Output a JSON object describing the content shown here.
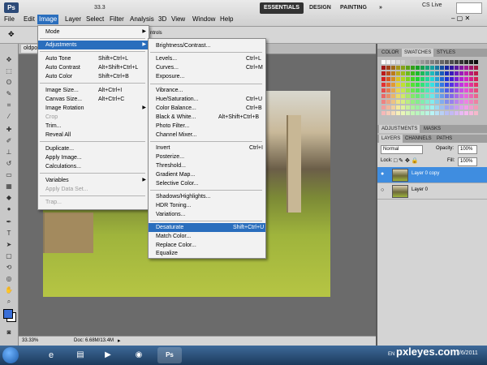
{
  "app": {
    "logo": "Ps",
    "zoom_readout": "33.3"
  },
  "menubar": {
    "items": [
      "File",
      "Edit",
      "Image",
      "Layer",
      "Select",
      "Filter",
      "Analysis",
      "3D",
      "View",
      "Window",
      "Help"
    ],
    "workspaces": [
      "ESSENTIALS",
      "DESIGN",
      "PAINTING"
    ],
    "more": "»",
    "cs_live": "CS Live",
    "window_controls": "– ▢ ✕"
  },
  "options": {
    "controls_label": "ntrols"
  },
  "document": {
    "tab_label": "oldpo",
    "zoom": "33.33%",
    "info": "Doc: 6.68M/13.4M"
  },
  "image_menu": {
    "items": [
      {
        "label": "Mode",
        "shortcut": "",
        "submenu": true,
        "disabled": false
      },
      {
        "label": "Adjustments",
        "shortcut": "",
        "submenu": true,
        "disabled": false,
        "highlight": true
      },
      {
        "label": "Auto Tone",
        "shortcut": "Shift+Ctrl+L",
        "disabled": false
      },
      {
        "label": "Auto Contrast",
        "shortcut": "Alt+Shift+Ctrl+L",
        "disabled": false
      },
      {
        "label": "Auto Color",
        "shortcut": "Shift+Ctrl+B",
        "disabled": false
      },
      {
        "label": "Image Size...",
        "shortcut": "Alt+Ctrl+I",
        "disabled": false
      },
      {
        "label": "Canvas Size...",
        "shortcut": "Alt+Ctrl+C",
        "disabled": false
      },
      {
        "label": "Image Rotation",
        "shortcut": "",
        "submenu": true,
        "disabled": false
      },
      {
        "label": "Crop",
        "shortcut": "",
        "disabled": true
      },
      {
        "label": "Trim...",
        "shortcut": "",
        "disabled": false
      },
      {
        "label": "Reveal All",
        "shortcut": "",
        "disabled": false
      },
      {
        "label": "Duplicate...",
        "shortcut": "",
        "disabled": false
      },
      {
        "label": "Apply Image...",
        "shortcut": "",
        "disabled": false
      },
      {
        "label": "Calculations...",
        "shortcut": "",
        "disabled": false
      },
      {
        "label": "Variables",
        "shortcut": "",
        "submenu": true,
        "disabled": false
      },
      {
        "label": "Apply Data Set...",
        "shortcut": "",
        "disabled": true
      },
      {
        "label": "Trap...",
        "shortcut": "",
        "disabled": true
      }
    ]
  },
  "adjust_menu": {
    "items": [
      {
        "label": "Brightness/Contrast...",
        "shortcut": ""
      },
      {
        "label": "Levels...",
        "shortcut": "Ctrl+L"
      },
      {
        "label": "Curves...",
        "shortcut": "Ctrl+M"
      },
      {
        "label": "Exposure...",
        "shortcut": ""
      },
      {
        "label": "Vibrance...",
        "shortcut": ""
      },
      {
        "label": "Hue/Saturation...",
        "shortcut": "Ctrl+U"
      },
      {
        "label": "Color Balance...",
        "shortcut": "Ctrl+B"
      },
      {
        "label": "Black & White...",
        "shortcut": "Alt+Shift+Ctrl+B"
      },
      {
        "label": "Photo Filter...",
        "shortcut": ""
      },
      {
        "label": "Channel Mixer...",
        "shortcut": ""
      },
      {
        "label": "Invert",
        "shortcut": "Ctrl+I"
      },
      {
        "label": "Posterize...",
        "shortcut": ""
      },
      {
        "label": "Threshold...",
        "shortcut": ""
      },
      {
        "label": "Gradient Map...",
        "shortcut": ""
      },
      {
        "label": "Selective Color...",
        "shortcut": ""
      },
      {
        "label": "Shadows/Highlights...",
        "shortcut": ""
      },
      {
        "label": "HDR Toning...",
        "shortcut": ""
      },
      {
        "label": "Variations...",
        "shortcut": ""
      },
      {
        "label": "Desaturate",
        "shortcut": "Shift+Ctrl+U",
        "highlight": true
      },
      {
        "label": "Match Color...",
        "shortcut": ""
      },
      {
        "label": "Replace Color...",
        "shortcut": ""
      },
      {
        "label": "Equalize",
        "shortcut": ""
      }
    ]
  },
  "panels": {
    "color_tabs": [
      "COLOR",
      "SWATCHES",
      "STYLES"
    ],
    "adj_tabs": [
      "ADJUSTMENTS",
      "MASKS"
    ],
    "layer_tabs": [
      "LAYERS",
      "CHANNELS",
      "PATHS"
    ],
    "blend_mode": "Normal",
    "opacity_label": "Opacity:",
    "opacity_value": "100%",
    "lock_label": "Lock:",
    "fill_label": "Fill:",
    "fill_value": "100%",
    "layers": [
      {
        "name": "Layer 0 copy",
        "selected": true
      },
      {
        "name": "Layer 0",
        "selected": false
      }
    ]
  },
  "taskbar": {
    "lang": "EN",
    "clock": "7/6/2011"
  },
  "watermark": "pxleyes.com",
  "colors": {
    "accent": "#2a6ebd",
    "fg_color": "#3a6fd8",
    "bg_color": "#ffffff"
  }
}
